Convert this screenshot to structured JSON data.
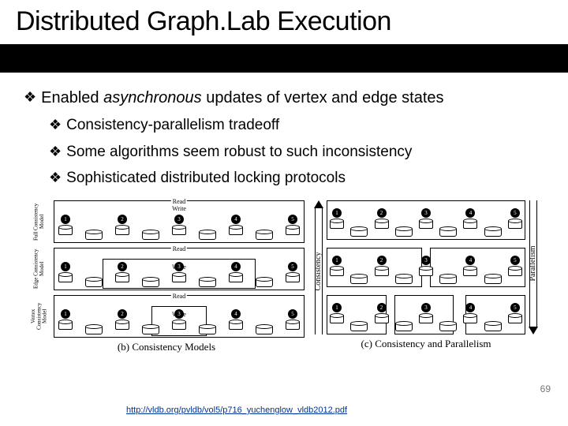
{
  "title": "Distributed Graph.Lab Execution",
  "bullets": {
    "main": {
      "pre": "Enabled ",
      "em": "asynchronous",
      "post": " updates of vertex and edge states"
    },
    "subs": [
      "Consistency-parallelism tradeoff",
      "Some algorithms seem robust to such inconsistency",
      "Sophisticated distributed locking protocols"
    ]
  },
  "bullet_glyph": "❖",
  "figure": {
    "panel_b": {
      "caption": "(b) Consistency Models",
      "row_labels": [
        "Full Consistency Model",
        "Edge Consistency Model",
        "Vertex Consistency Model"
      ],
      "scope_read": "Read",
      "scope_write": "Write",
      "node_ids": [
        "1",
        "2",
        "3",
        "4",
        "5"
      ]
    },
    "panel_c": {
      "caption": "(c) Consistency and Parallelism",
      "left_axis": "Consistency",
      "right_axis": "Parallelism",
      "node_ids": [
        "1",
        "2",
        "3",
        "4",
        "5"
      ]
    }
  },
  "footer": {
    "link_text": "http://vldb.org/pvldb/vol5/p716_yuchenglow_vldb2012.pdf",
    "page_num": "69"
  }
}
